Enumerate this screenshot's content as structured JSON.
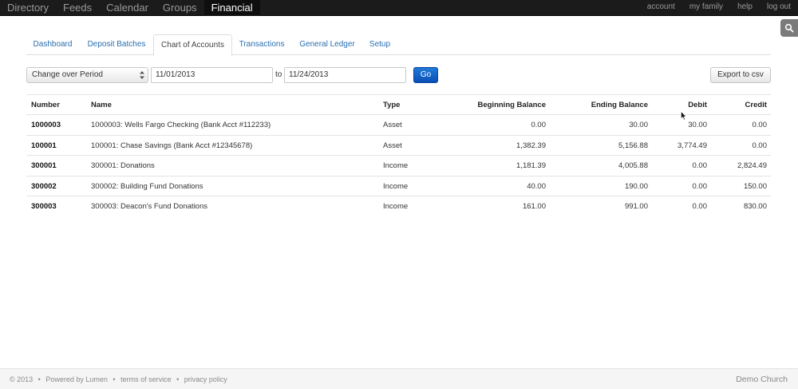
{
  "topnav": {
    "items": [
      "Directory",
      "Feeds",
      "Calendar",
      "Groups",
      "Financial"
    ],
    "active": "Financial",
    "right_links": [
      "account",
      "my family",
      "help",
      "log out"
    ]
  },
  "tabs": {
    "items": [
      "Dashboard",
      "Deposit Batches",
      "Chart of Accounts",
      "Transactions",
      "General Ledger",
      "Setup"
    ],
    "active": "Chart of Accounts"
  },
  "filter": {
    "period_select": "Change over Period",
    "start_date": "11/01/2013",
    "to_label": "to",
    "end_date": "11/24/2013",
    "go_label": "Go",
    "export_label": "Export to csv"
  },
  "table": {
    "headers": [
      "Number",
      "Name",
      "Type",
      "Beginning Balance",
      "Ending Balance",
      "Debit",
      "Credit"
    ],
    "rows": [
      [
        "1000003",
        "1000003: Wells Fargo Checking (Bank Acct #112233)",
        "Asset",
        "0.00",
        "30.00",
        "30.00",
        "0.00"
      ],
      [
        "100001",
        "100001: Chase Savings (Bank Acct #12345678)",
        "Asset",
        "1,382.39",
        "5,156.88",
        "3,774.49",
        "0.00"
      ],
      [
        "300001",
        "300001: Donations",
        "Income",
        "1,181.39",
        "4,005.88",
        "0.00",
        "2,824.49"
      ],
      [
        "300002",
        "300002: Building Fund Donations",
        "Income",
        "40.00",
        "190.00",
        "0.00",
        "150.00"
      ],
      [
        "300003",
        "300003: Deacon's Fund Donations",
        "Income",
        "161.00",
        "991.00",
        "0.00",
        "830.00"
      ]
    ]
  },
  "footer": {
    "copyright": "© 2013",
    "powered": "Powered by Lumen",
    "terms": "terms of service",
    "privacy": "privacy policy",
    "separator": "•",
    "org": "Demo Church"
  },
  "colors": {
    "topbar": "#1b1b1b",
    "link": "#2a6fb0",
    "go_button": "#0a4fb6"
  }
}
